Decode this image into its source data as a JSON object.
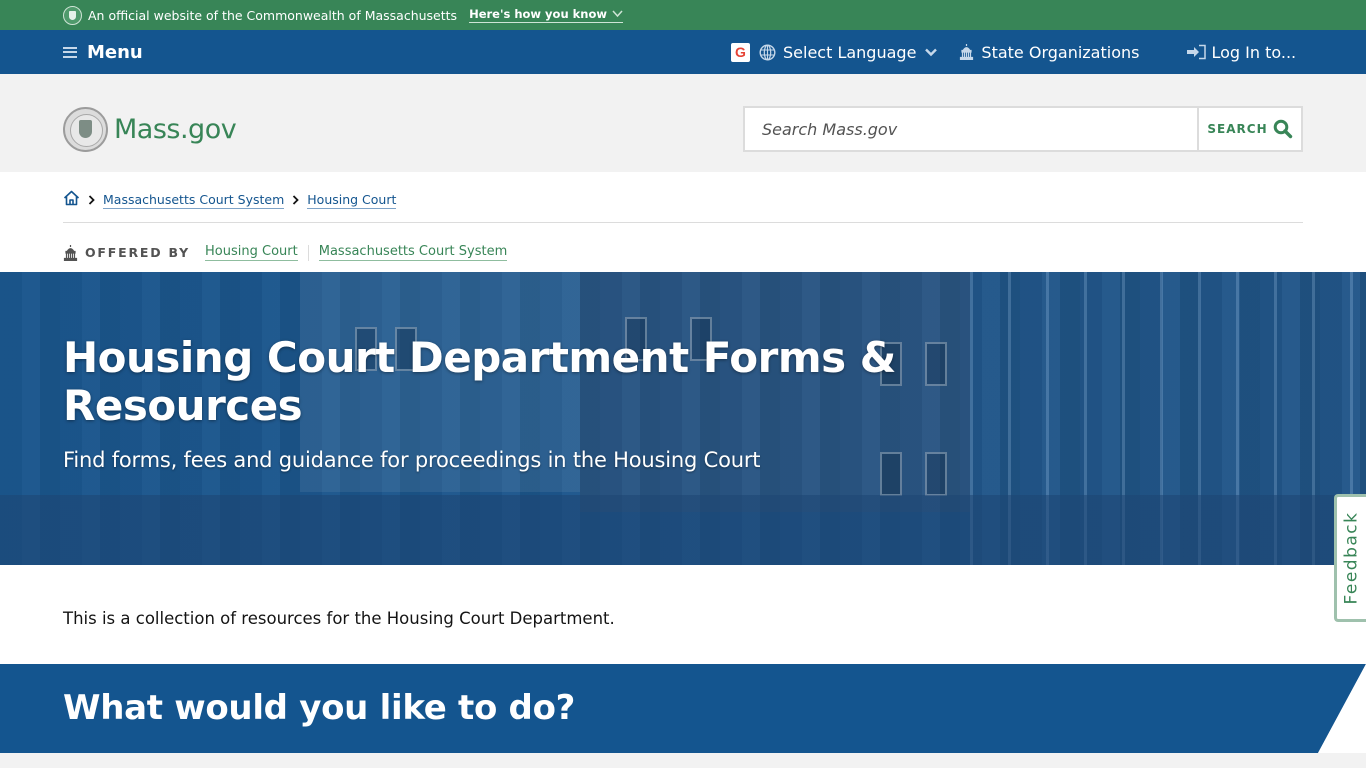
{
  "official_banner": {
    "text": "An official website of the Commonwealth of Massachusetts",
    "link_label": "Here's how you know"
  },
  "utility_nav": {
    "menu_label": "Menu",
    "google_badge": "G",
    "language_label": "Select Language",
    "state_orgs_label": "State Organizations",
    "login_label": "Log In to..."
  },
  "header": {
    "logo_text": "Mass.gov",
    "search_placeholder": "Search Mass.gov",
    "search_button_label": "SEARCH"
  },
  "breadcrumb": {
    "items": [
      {
        "label": "Massachusetts Court System"
      },
      {
        "label": "Housing Court"
      }
    ]
  },
  "offered_by": {
    "label": "OFFERED BY",
    "orgs": [
      {
        "label": "Housing Court"
      },
      {
        "label": "Massachusetts Court System"
      }
    ]
  },
  "hero": {
    "title": "Housing Court Department Forms & Resources",
    "subtitle": "Find forms, fees and guidance for proceedings in the Housing Court"
  },
  "intro": {
    "text": "This is a collection of resources for the Housing Court Department."
  },
  "section": {
    "heading": "What would you like to do?"
  },
  "feedback": {
    "label": "Feedback"
  },
  "colors": {
    "official_green": "#388557",
    "nav_blue": "#14558f",
    "header_gray": "#f2f2f2"
  }
}
